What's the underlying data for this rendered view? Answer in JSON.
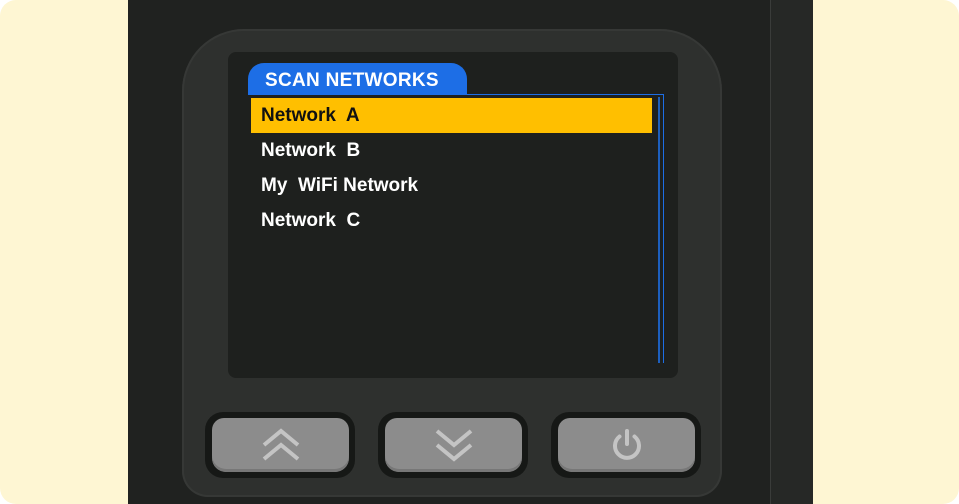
{
  "screen": {
    "title": "SCAN NETWORKS",
    "selected_index": 0,
    "networks": [
      {
        "label": "Network  A"
      },
      {
        "label": "Network  B"
      },
      {
        "label": "My  WiFi Network"
      },
      {
        "label": "Network  C"
      }
    ]
  },
  "buttons": {
    "up": {
      "icon": "double-chevron-up-icon"
    },
    "down": {
      "icon": "double-chevron-down-icon"
    },
    "power": {
      "icon": "power-icon"
    }
  },
  "colors": {
    "accent": "#1d6ee6",
    "highlight": "#ffbf00",
    "screen_bg": "#1e201e",
    "button": "#8c8c8c",
    "background": "#fef6d3"
  }
}
